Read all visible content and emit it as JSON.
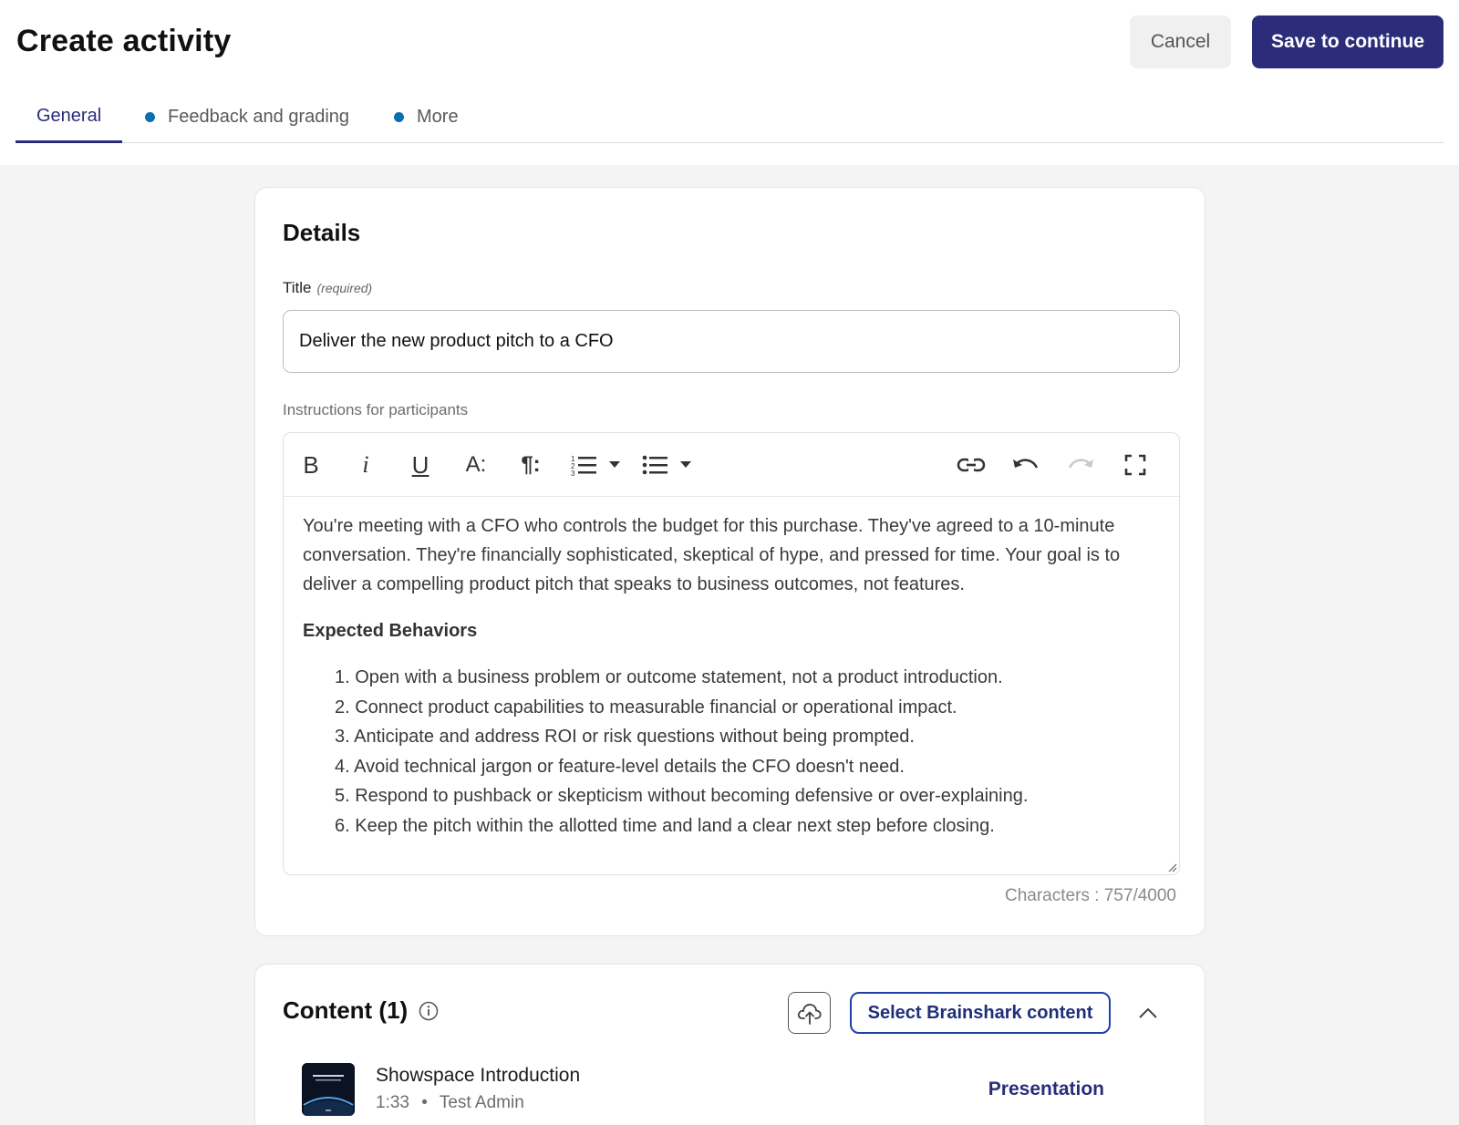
{
  "header": {
    "title": "Create activity",
    "cancel_label": "Cancel",
    "save_label": "Save to continue"
  },
  "tabs": [
    {
      "label": "General",
      "active": true
    },
    {
      "label": "Feedback and grading",
      "active": false,
      "indicator": "dot"
    },
    {
      "label": "More",
      "active": false,
      "indicator": "dot"
    }
  ],
  "details": {
    "heading": "Details",
    "title_label": "Title",
    "title_required": "(required)",
    "title_value": "Deliver the new product pitch to a CFO",
    "instructions_label": "Instructions for participants",
    "toolbar": {
      "bold": "B",
      "italic": "i",
      "underline": "U",
      "font_size": "A:",
      "paragraph": "¶:",
      "icons": [
        "bold-icon",
        "italic-icon",
        "underline-icon",
        "font-size-icon",
        "paragraph-format-icon",
        "ordered-list-icon",
        "chevron-down-icon",
        "unordered-list-icon",
        "chevron-down-icon",
        "link-icon",
        "undo-icon",
        "redo-icon",
        "fullscreen-icon"
      ]
    },
    "instructions": {
      "intro": "You're meeting with a CFO who controls the budget for this purchase. They've agreed to a 10-minute conversation. They're financially sophisticated, skeptical of hype, and pressed for time. Your goal is to deliver a compelling product pitch that speaks to business outcomes, not features.",
      "subheading": "Expected Behaviors",
      "items": [
        "1. Open with a business problem or outcome statement, not a product introduction.",
        "2. Connect product capabilities to measurable financial or operational impact.",
        "3. Anticipate and address ROI or risk questions without being prompted.",
        "4. Avoid technical jargon or feature-level details the CFO doesn't need.",
        "5. Respond to pushback or skepticism without becoming defensive or over-explaining.",
        "6. Keep the pitch within the allotted time and land a clear next step before closing."
      ]
    },
    "char_count": "Characters : 757/4000"
  },
  "content": {
    "heading": "Content (1)",
    "select_label": "Select Brainshark content",
    "items": [
      {
        "title": "Showspace Introduction",
        "duration": "1:33",
        "separator": "•",
        "author": "Test Admin",
        "type": "Presentation"
      }
    ]
  },
  "colors": {
    "primary": "#2b2c7a",
    "tab_dot": "#0a6fb0",
    "page_bg": "#f4f4f4"
  }
}
